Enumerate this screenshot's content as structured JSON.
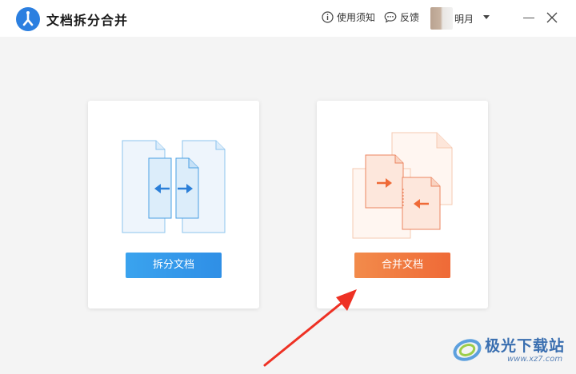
{
  "window": {
    "title": "文档拆分合并",
    "notice_label": "使用须知",
    "feedback_label": "反馈",
    "user_name": "明月"
  },
  "cards": {
    "split": {
      "button_label": "拆分文档"
    },
    "merge": {
      "button_label": "合并文档"
    }
  },
  "watermark": {
    "brand": "极光下载站",
    "url": "www.xz7.com"
  },
  "colors": {
    "split_accent": "#2f8fe6",
    "merge_accent": "#ef6a37",
    "annotation_arrow": "#ee3124"
  },
  "icons": [
    "app-logo-icon",
    "info-icon",
    "chat-bubble-icon",
    "chevron-down-icon",
    "minimize-icon",
    "close-icon",
    "split-document-icon",
    "merge-document-icon",
    "pointer-arrow-icon",
    "aurora-logo-icon"
  ]
}
